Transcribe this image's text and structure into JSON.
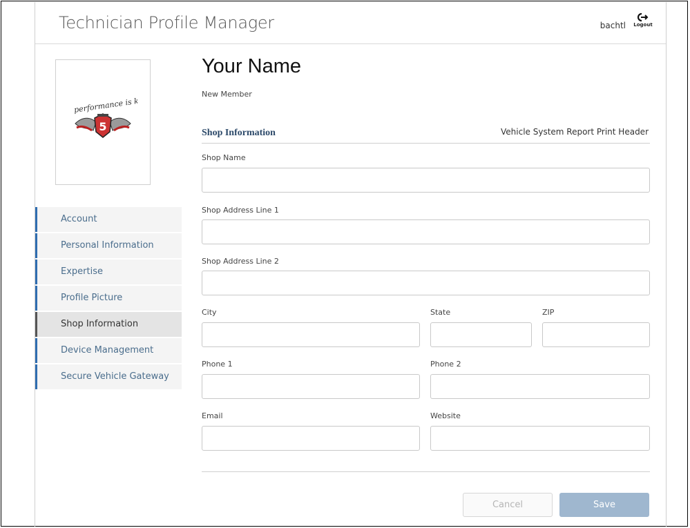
{
  "header": {
    "app_title": "Technician Profile Manager",
    "username": "bachtl",
    "logout_label": "Logout"
  },
  "profile": {
    "name": "Your Name",
    "member_status": "New Member",
    "logo_alt": "performance is king"
  },
  "sidebar": {
    "items": [
      {
        "label": "Account"
      },
      {
        "label": "Personal Information"
      },
      {
        "label": "Expertise"
      },
      {
        "label": "Profile Picture"
      },
      {
        "label": "Shop Information",
        "active": true
      },
      {
        "label": "Device Management"
      },
      {
        "label": "Secure Vehicle Gateway"
      }
    ]
  },
  "form": {
    "section_title": "Shop Information",
    "print_header_label": "Vehicle System Report Print Header",
    "fields": {
      "shop_name": {
        "label": "Shop Name",
        "value": ""
      },
      "address1": {
        "label": "Shop Address Line 1",
        "value": ""
      },
      "address2": {
        "label": "Shop Address Line 2",
        "value": ""
      },
      "city": {
        "label": "City",
        "value": ""
      },
      "state": {
        "label": "State",
        "value": ""
      },
      "zip": {
        "label": "ZIP",
        "value": ""
      },
      "phone1": {
        "label": "Phone 1",
        "value": ""
      },
      "phone2": {
        "label": "Phone 2",
        "value": ""
      },
      "email": {
        "label": "Email",
        "value": ""
      },
      "website": {
        "label": "Website",
        "value": ""
      }
    },
    "cancel_label": "Cancel",
    "save_label": "Save"
  },
  "colors": {
    "sidebar_accent": "#2f6db0",
    "section_title": "#2d4a6a",
    "save_button": "#9fb7cf"
  },
  "icons": {
    "logout": "logout-arrow-icon",
    "logo": "performance-is-king-logo"
  }
}
